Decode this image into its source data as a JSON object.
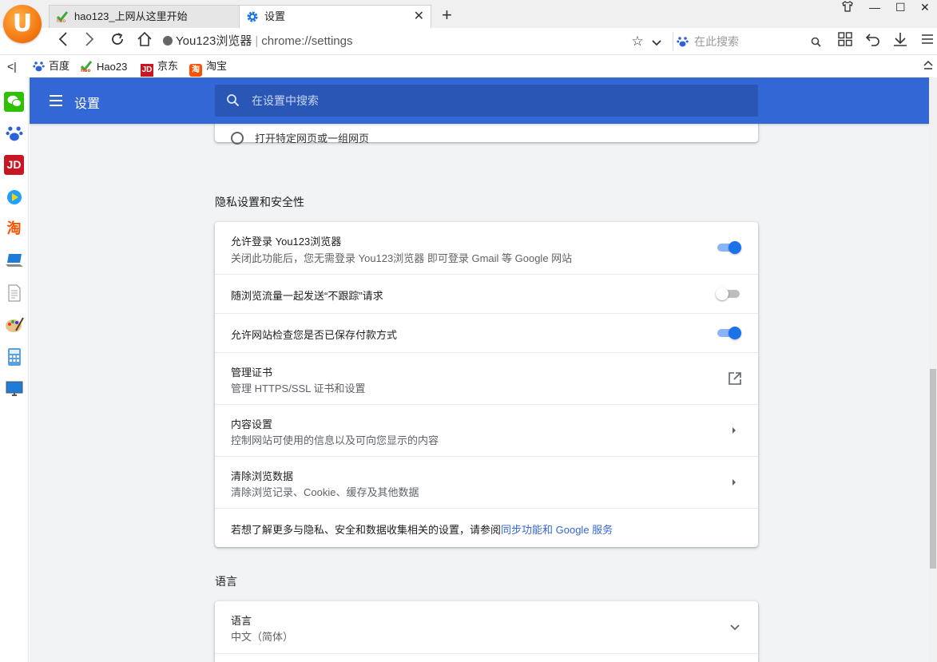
{
  "tabs": [
    {
      "title": "hao123_上网从这里开始",
      "icon": "hao123-icon"
    },
    {
      "title": "设置",
      "icon": "gear-icon"
    }
  ],
  "address": {
    "site": "You123浏览器",
    "url": "chrome://settings"
  },
  "browser_search": {
    "placeholder": "在此搜索"
  },
  "bookmarks": [
    {
      "label": "百度"
    },
    {
      "label": "Hao23"
    },
    {
      "label": "京东"
    },
    {
      "label": "淘宝"
    }
  ],
  "settings_header": {
    "title": "设置",
    "search_placeholder": "在设置中搜索"
  },
  "previous_card": {
    "option": "打开特定网页或一组网页"
  },
  "privacy": {
    "section_title": "隐私设置和安全性",
    "allow_login": {
      "title": "允许登录 You123浏览器",
      "subtitle": "关闭此功能后，您无需登录 You123浏览器 即可登录 Gmail 等 Google 网站",
      "enabled": true
    },
    "do_not_track": {
      "title": "随浏览流量一起发送“不跟踪”请求",
      "enabled": false
    },
    "payment_check": {
      "title": "允许网站检查您是否已保存付款方式",
      "enabled": true
    },
    "certificates": {
      "title": "管理证书",
      "subtitle": "管理 HTTPS/SSL 证书和设置"
    },
    "content_settings": {
      "title": "内容设置",
      "subtitle": "控制网站可使用的信息以及可向您显示的内容"
    },
    "clear_data": {
      "title": "清除浏览数据",
      "subtitle": "清除浏览记录、Cookie、缓存及其他数据"
    },
    "learn_more": {
      "text": "若想了解更多与隐私、安全和数据收集相关的设置，请参阅",
      "link": "同步功能和 Google 服务"
    }
  },
  "language": {
    "section_title": "语言",
    "row_title": "语言",
    "row_value": "中文（简体）"
  },
  "colors": {
    "header": "#3367d6",
    "toggle_on": "#1a73e8",
    "link": "#3367d6"
  }
}
